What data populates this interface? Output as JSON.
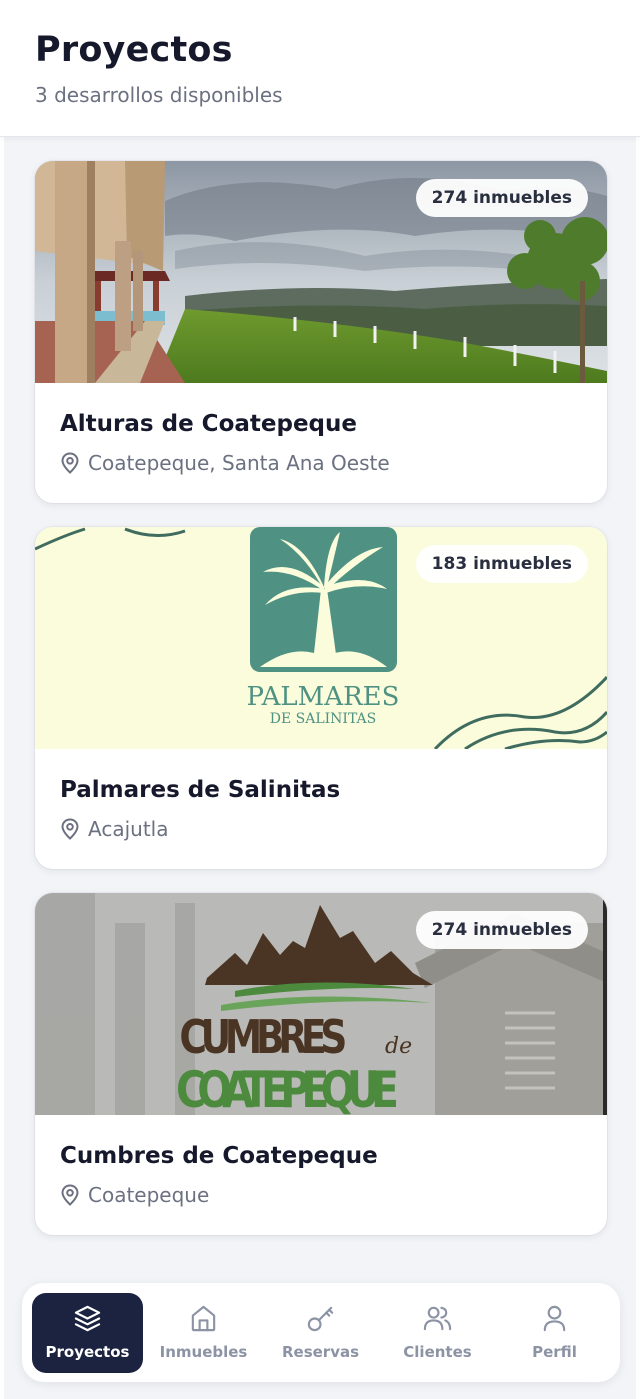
{
  "header": {
    "title": "Proyectos",
    "subtitle": "3 desarrollos disponibles"
  },
  "projects": [
    {
      "name": "Alturas de Coatepeque",
      "location": "Coatepeque, Santa Ana Oeste",
      "badge": "274 inmuebles",
      "image": "photo-landscape-lake-view"
    },
    {
      "name": "Palmares de Salinitas",
      "location": "Acajutla",
      "badge": "183 inmuebles",
      "image": "logo-palmares",
      "logo_text": {
        "line1": "PALMARES",
        "line2": "DE SALINITAS"
      }
    },
    {
      "name": "Cumbres de Coatepeque",
      "location": "Coatepeque",
      "badge": "274 inmuebles",
      "image": "logo-cumbres",
      "logo_text": {
        "line1": "CUMBRES",
        "de": "de",
        "line2": "COATEPEQUE"
      }
    }
  ],
  "nav": [
    {
      "label": "Proyectos",
      "icon": "layers-icon",
      "active": true
    },
    {
      "label": "Inmuebles",
      "icon": "home-icon",
      "active": false
    },
    {
      "label": "Reservas",
      "icon": "key-icon",
      "active": false
    },
    {
      "label": "Clientes",
      "icon": "users-icon",
      "active": false
    },
    {
      "label": "Perfil",
      "icon": "user-icon",
      "active": false
    }
  ],
  "colors": {
    "primary": "#1b2340",
    "background": "#f2f4f7",
    "muted_text": "#6b7180",
    "palmares_green": "#4f9283",
    "cumbres_brown": "#4a3524",
    "cumbres_green": "#4c8a3e"
  }
}
